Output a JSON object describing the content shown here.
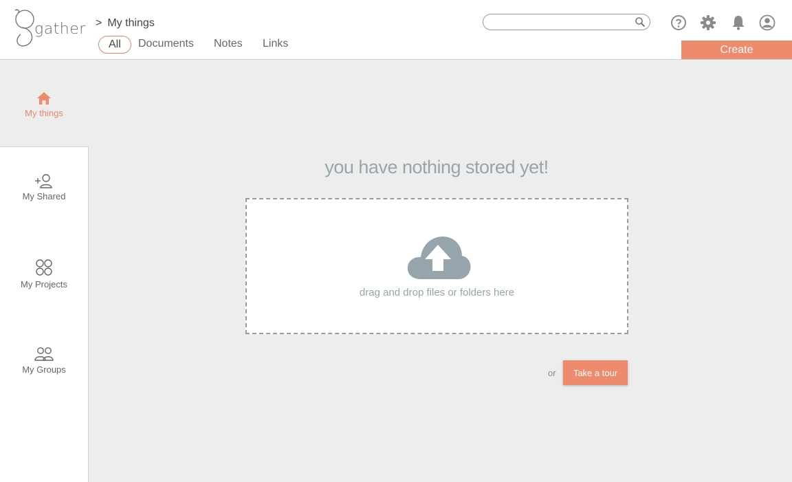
{
  "app": {
    "logo_text": "gather"
  },
  "breadcrumb": {
    "separator": ">",
    "current": "My things"
  },
  "tabs": [
    {
      "label": "All",
      "active": true
    },
    {
      "label": "Documents",
      "active": false
    },
    {
      "label": "Notes",
      "active": false
    },
    {
      "label": "Links",
      "active": false
    }
  ],
  "search": {
    "value": "",
    "placeholder": ""
  },
  "header_icons": [
    "help-icon",
    "gear-icon",
    "bell-icon",
    "user-icon"
  ],
  "create_label": "Create",
  "sidebar": {
    "items": [
      {
        "label": "My things",
        "icon": "home-icon",
        "active": true
      },
      {
        "label": "My Shared",
        "icon": "add-user-icon",
        "active": false
      },
      {
        "label": "My Projects",
        "icon": "projects-icon",
        "active": false
      },
      {
        "label": "My Groups",
        "icon": "groups-icon",
        "active": false
      }
    ]
  },
  "main": {
    "empty_title": "you have nothing stored yet!",
    "drop_text": "drag and drop files or folders here",
    "or_text": "or",
    "tour_label": "Take a tour"
  },
  "colors": {
    "accent": "#ee8b6d",
    "muted_blue_gray": "#95a5ab",
    "background": "#ededed"
  }
}
